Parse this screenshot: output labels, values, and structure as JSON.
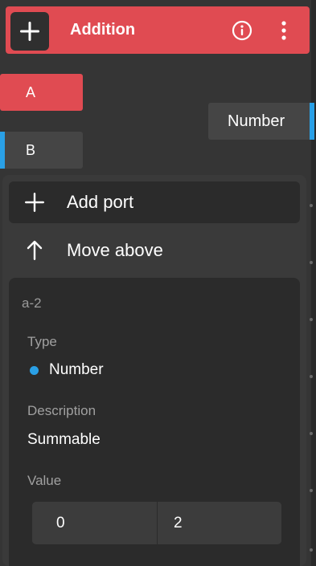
{
  "node": {
    "title": "Addition",
    "colors": {
      "header": "#e04b52",
      "accent": "#2aa0e6",
      "background": "#353535"
    },
    "icons": {
      "add": "plus-icon",
      "info": "info-icon",
      "menu": "more-vertical-icon"
    }
  },
  "ports": {
    "inputs": [
      {
        "label": "A"
      },
      {
        "label": "B"
      }
    ],
    "output": {
      "label": "Number"
    }
  },
  "context_menu": {
    "add_port": "Add port",
    "move_above": "Move above"
  },
  "port_panel": {
    "id": "a-2",
    "type_label": "Type",
    "type_value": "Number",
    "description_label": "Description",
    "description_value": "Summable",
    "value_label": "Value",
    "values": [
      "0",
      "2"
    ]
  }
}
